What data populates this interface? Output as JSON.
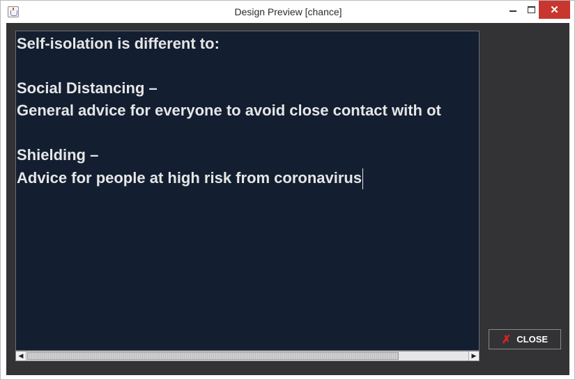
{
  "window": {
    "title": "Design Preview [chance]",
    "minimize_glyph": "",
    "maximize_glyph": "",
    "close_glyph": "✕"
  },
  "editor": {
    "lines": [
      "Self-isolation is different to:",
      "",
      "Social Distancing –",
      "General advice for everyone to avoid close contact with ot",
      "",
      "Shielding –",
      "Advice for people at high risk from coronavirus"
    ]
  },
  "scrollbar": {
    "left_arrow": "◀",
    "right_arrow": "▶"
  },
  "actions": {
    "close_icon": "✗",
    "close_label": "CLOSE"
  },
  "colors": {
    "editor_bg": "#131e31",
    "client_bg": "#333336",
    "text": "#e6e6e6",
    "close_icon": "#e0221b",
    "titlebar_close": "#c7372f"
  }
}
